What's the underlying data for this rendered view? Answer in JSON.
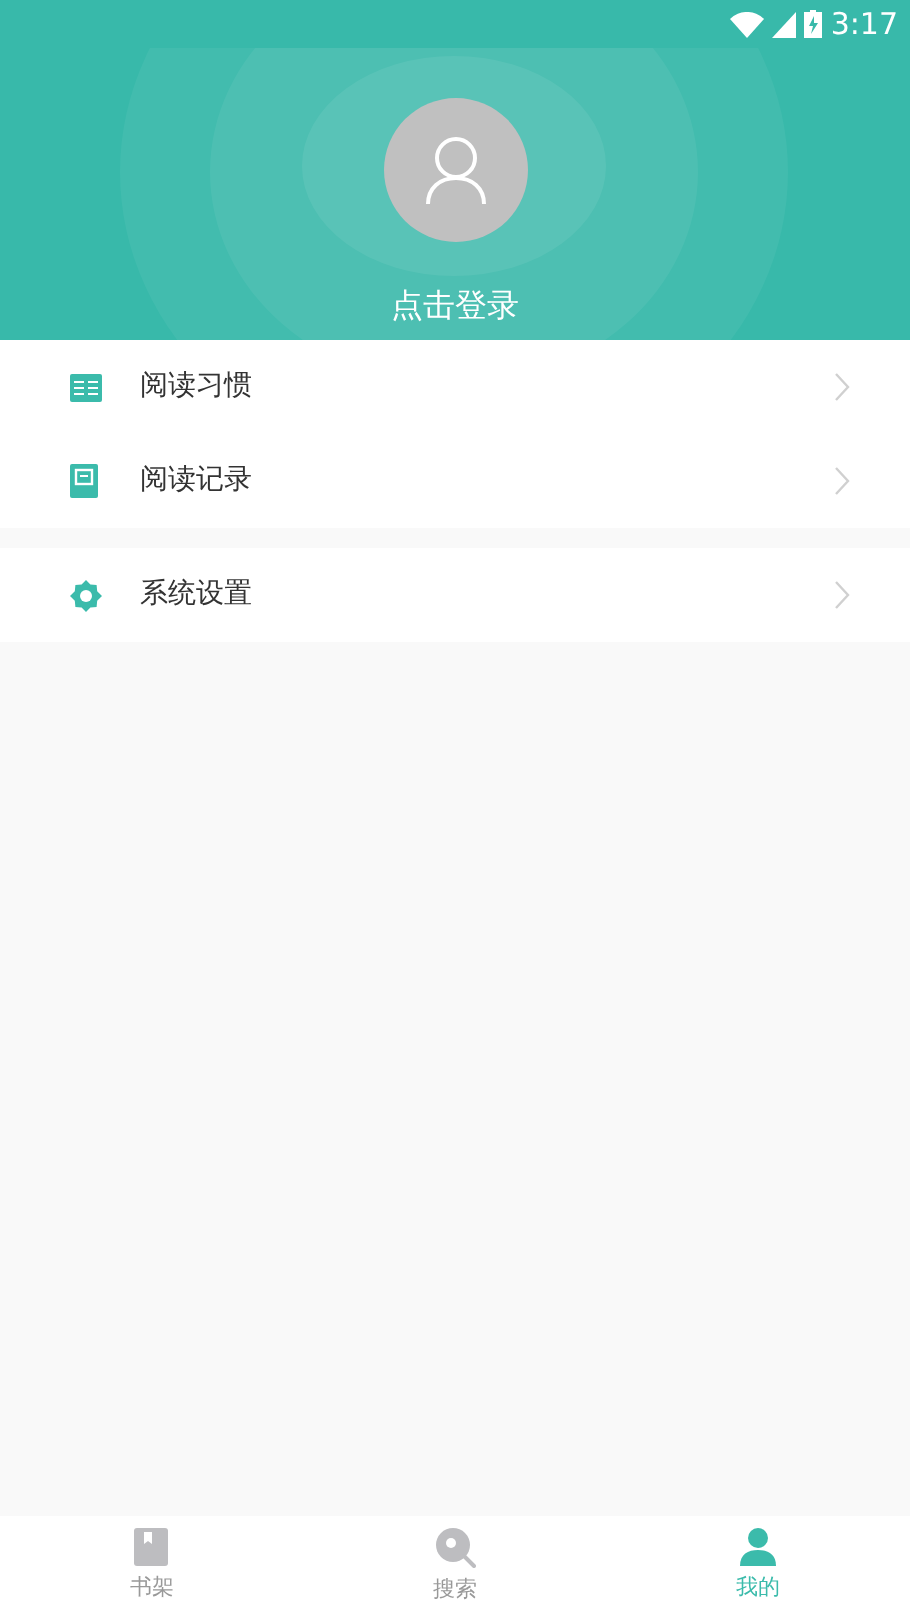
{
  "status_bar": {
    "time": "3:17"
  },
  "profile": {
    "login_label": "点击登录"
  },
  "menu_groups": [
    [
      {
        "label": "阅读习惯",
        "kind": "habit"
      },
      {
        "label": "阅读记录",
        "kind": "history"
      }
    ],
    [
      {
        "label": "系统设置",
        "kind": "settings"
      }
    ]
  ],
  "bottom_nav": [
    {
      "label": "书架",
      "kind": "shelf",
      "selected": false
    },
    {
      "label": "搜索",
      "kind": "search",
      "selected": false
    },
    {
      "label": "我的",
      "kind": "me",
      "selected": true
    }
  ]
}
